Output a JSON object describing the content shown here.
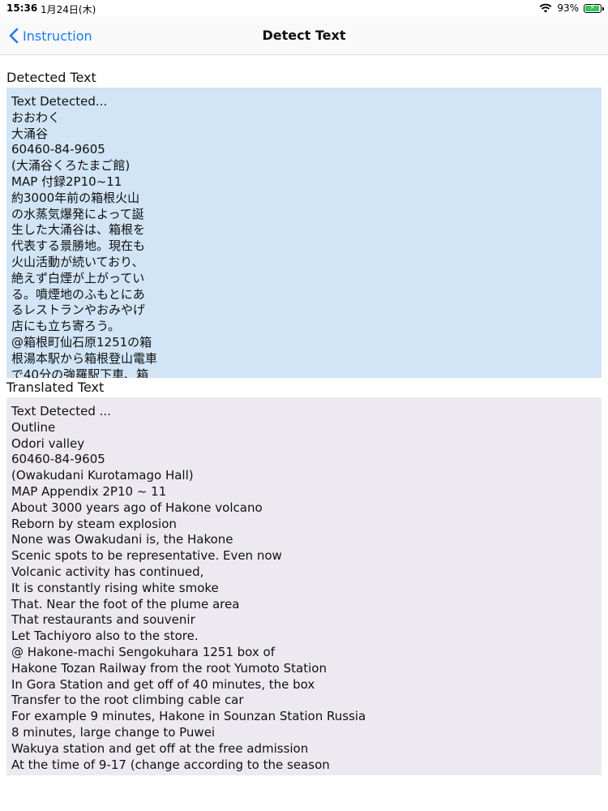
{
  "status": {
    "time": "15:36",
    "date": "1月24日(木)",
    "battery": "93%",
    "battery_level": 0.93,
    "colors": {
      "battery": "#34c759"
    }
  },
  "nav": {
    "back_label": "Instruction",
    "title": "Detect Text",
    "accent": "#1d7bf0"
  },
  "detected": {
    "label": "Detected Text",
    "lines": [
      "Text Detected...",
      "おおわく",
      "大涌谷",
      "60460-84-9605",
      "(大涌谷くろたまご館)",
      "MAP 付録2P10~11",
      "約3000年前の箱根火山",
      "の水蒸気爆発によって誕",
      "生した大涌谷は、箱根を",
      "代表する景勝地。現在も",
      "火山活動が続いており、",
      "絶えず白煙が上がってい",
      "る。噴煙地のふもとにあ",
      "るレストランやおみやげ",
      "店にも立ち寄ろう。",
      "@箱根町仙石原1251の箱",
      "根湯本駅から箱根登山電車",
      "で40分の強羅駅下車、箱"
    ]
  },
  "translated": {
    "label": "Translated Text",
    "lines": [
      "Text Detected ...",
      "Outline",
      "Odori valley",
      "60460-84-9605",
      "(Owakudani Kurotamago Hall)",
      "MAP Appendix 2P10 ~ 11",
      "About 3000 years ago of Hakone volcano",
      "Reborn by steam explosion",
      "None was Owakudani is, the Hakone",
      "Scenic spots to be representative. Even now",
      "Volcanic activity has continued,",
      "It is constantly rising white smoke",
      "That. Near the foot of the plume area",
      "That restaurants and souvenir",
      "Let Tachiyoro also to the store.",
      "@ Hakone-machi Sengokuhara 1251 box of",
      "Hakone Tozan Railway from the root Yumoto Station",
      "In Gora Station and get off of 40 minutes, the box",
      "Transfer to the root climbing cable car",
      "For example 9 minutes, Hakone in Sounzan Station Russia",
      "8 minutes, large change to Puwei",
      "Wakuya station and get off at the free admission",
      "At the time of 9-17 (change according to the season"
    ]
  }
}
